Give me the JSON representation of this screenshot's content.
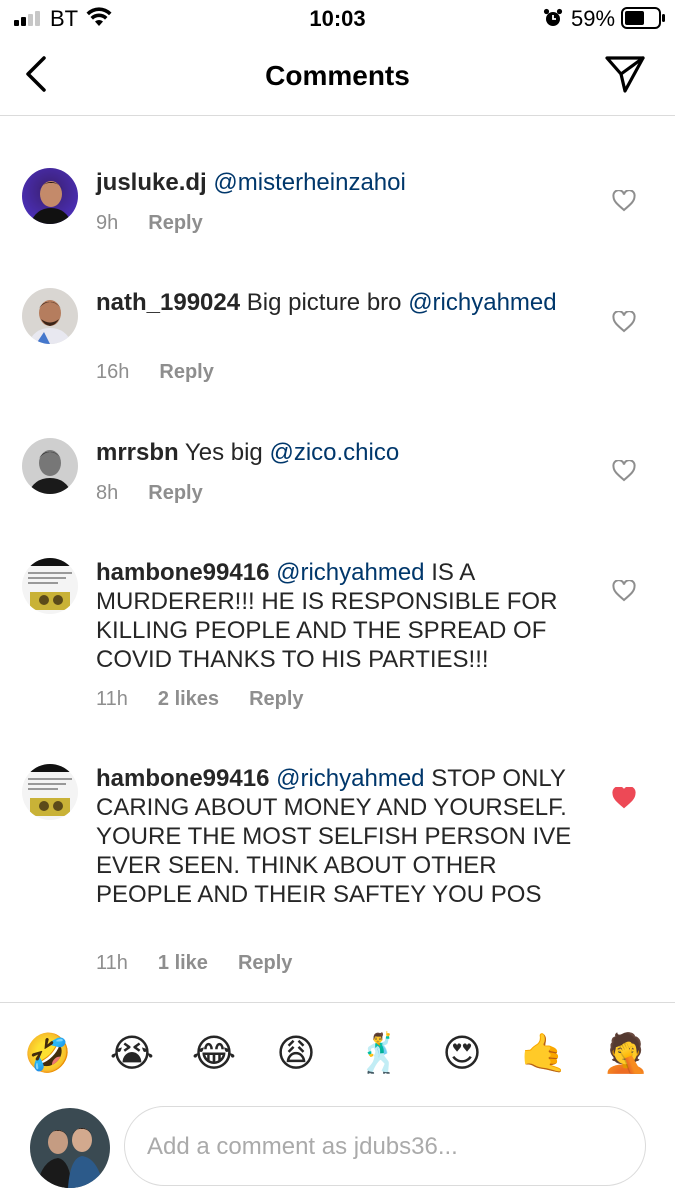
{
  "status_bar": {
    "carrier": "BT",
    "time": "10:03",
    "battery_percent": "59%",
    "battery_level": 0.59
  },
  "header": {
    "title": "Comments",
    "back_icon": "chevron-left-icon",
    "send_icon": "paper-plane-icon"
  },
  "comments": [
    {
      "username": "jusluke.dj",
      "segments": [
        {
          "type": "mention",
          "text": "@misterheinzahoi"
        }
      ],
      "time": "9h",
      "likes": "",
      "reply_label": "Reply",
      "liked": false
    },
    {
      "username": "nath_199024",
      "segments": [
        {
          "type": "text",
          "text": "Big picture bro"
        },
        {
          "type": "mention",
          "text": "@richyahmed"
        }
      ],
      "time": "16h",
      "likes": "",
      "reply_label": "Reply",
      "liked": false
    },
    {
      "username": "mrrsbn",
      "segments": [
        {
          "type": "text",
          "text": "Yes big"
        },
        {
          "type": "mention",
          "text": "@zico.chico"
        }
      ],
      "time": "8h",
      "likes": "",
      "reply_label": "Reply",
      "liked": false
    },
    {
      "username": "hambone99416",
      "segments": [
        {
          "type": "mention",
          "text": "@richyahmed"
        },
        {
          "type": "text",
          "text": "IS A MURDERER!!! HE IS RESPONSIBLE FOR KILLING PEOPLE AND THE SPREAD OF COVID THANKS TO HIS PARTIES!!!"
        }
      ],
      "time": "11h",
      "likes": "2 likes",
      "reply_label": "Reply",
      "liked": false
    },
    {
      "username": "hambone99416",
      "segments": [
        {
          "type": "mention",
          "text": "@richyahmed"
        },
        {
          "type": "text",
          "text": "STOP ONLY CARING ABOUT MONEY AND YOURSELF. YOURE THE MOST SELFISH PERSON IVE EVER SEEN. THINK ABOUT OTHER PEOPLE AND THEIR SAFTEY YOU POS"
        }
      ],
      "time": "11h",
      "likes": "1 like",
      "reply_label": "Reply",
      "liked": true
    }
  ],
  "emoji_bar": [
    {
      "name": "rolling-on-floor-laughing",
      "char": "🤣"
    },
    {
      "name": "loudly-crying",
      "char": "😭"
    },
    {
      "name": "tears-of-joy",
      "char": "😂"
    },
    {
      "name": "weary-face",
      "char": "😩"
    },
    {
      "name": "man-dancing",
      "char": "🕺"
    },
    {
      "name": "heart-eyes",
      "char": "😍"
    },
    {
      "name": "call-me-hand",
      "char": "🤙"
    },
    {
      "name": "man-facepalming",
      "char": "🤦"
    }
  ],
  "composer": {
    "placeholder": "Add a comment as jdubs36..."
  },
  "colors": {
    "mention": "#00376b",
    "liked_heart": "#ed4956",
    "meta_text": "#8e8e8e",
    "divider": "#dbdbdb"
  }
}
